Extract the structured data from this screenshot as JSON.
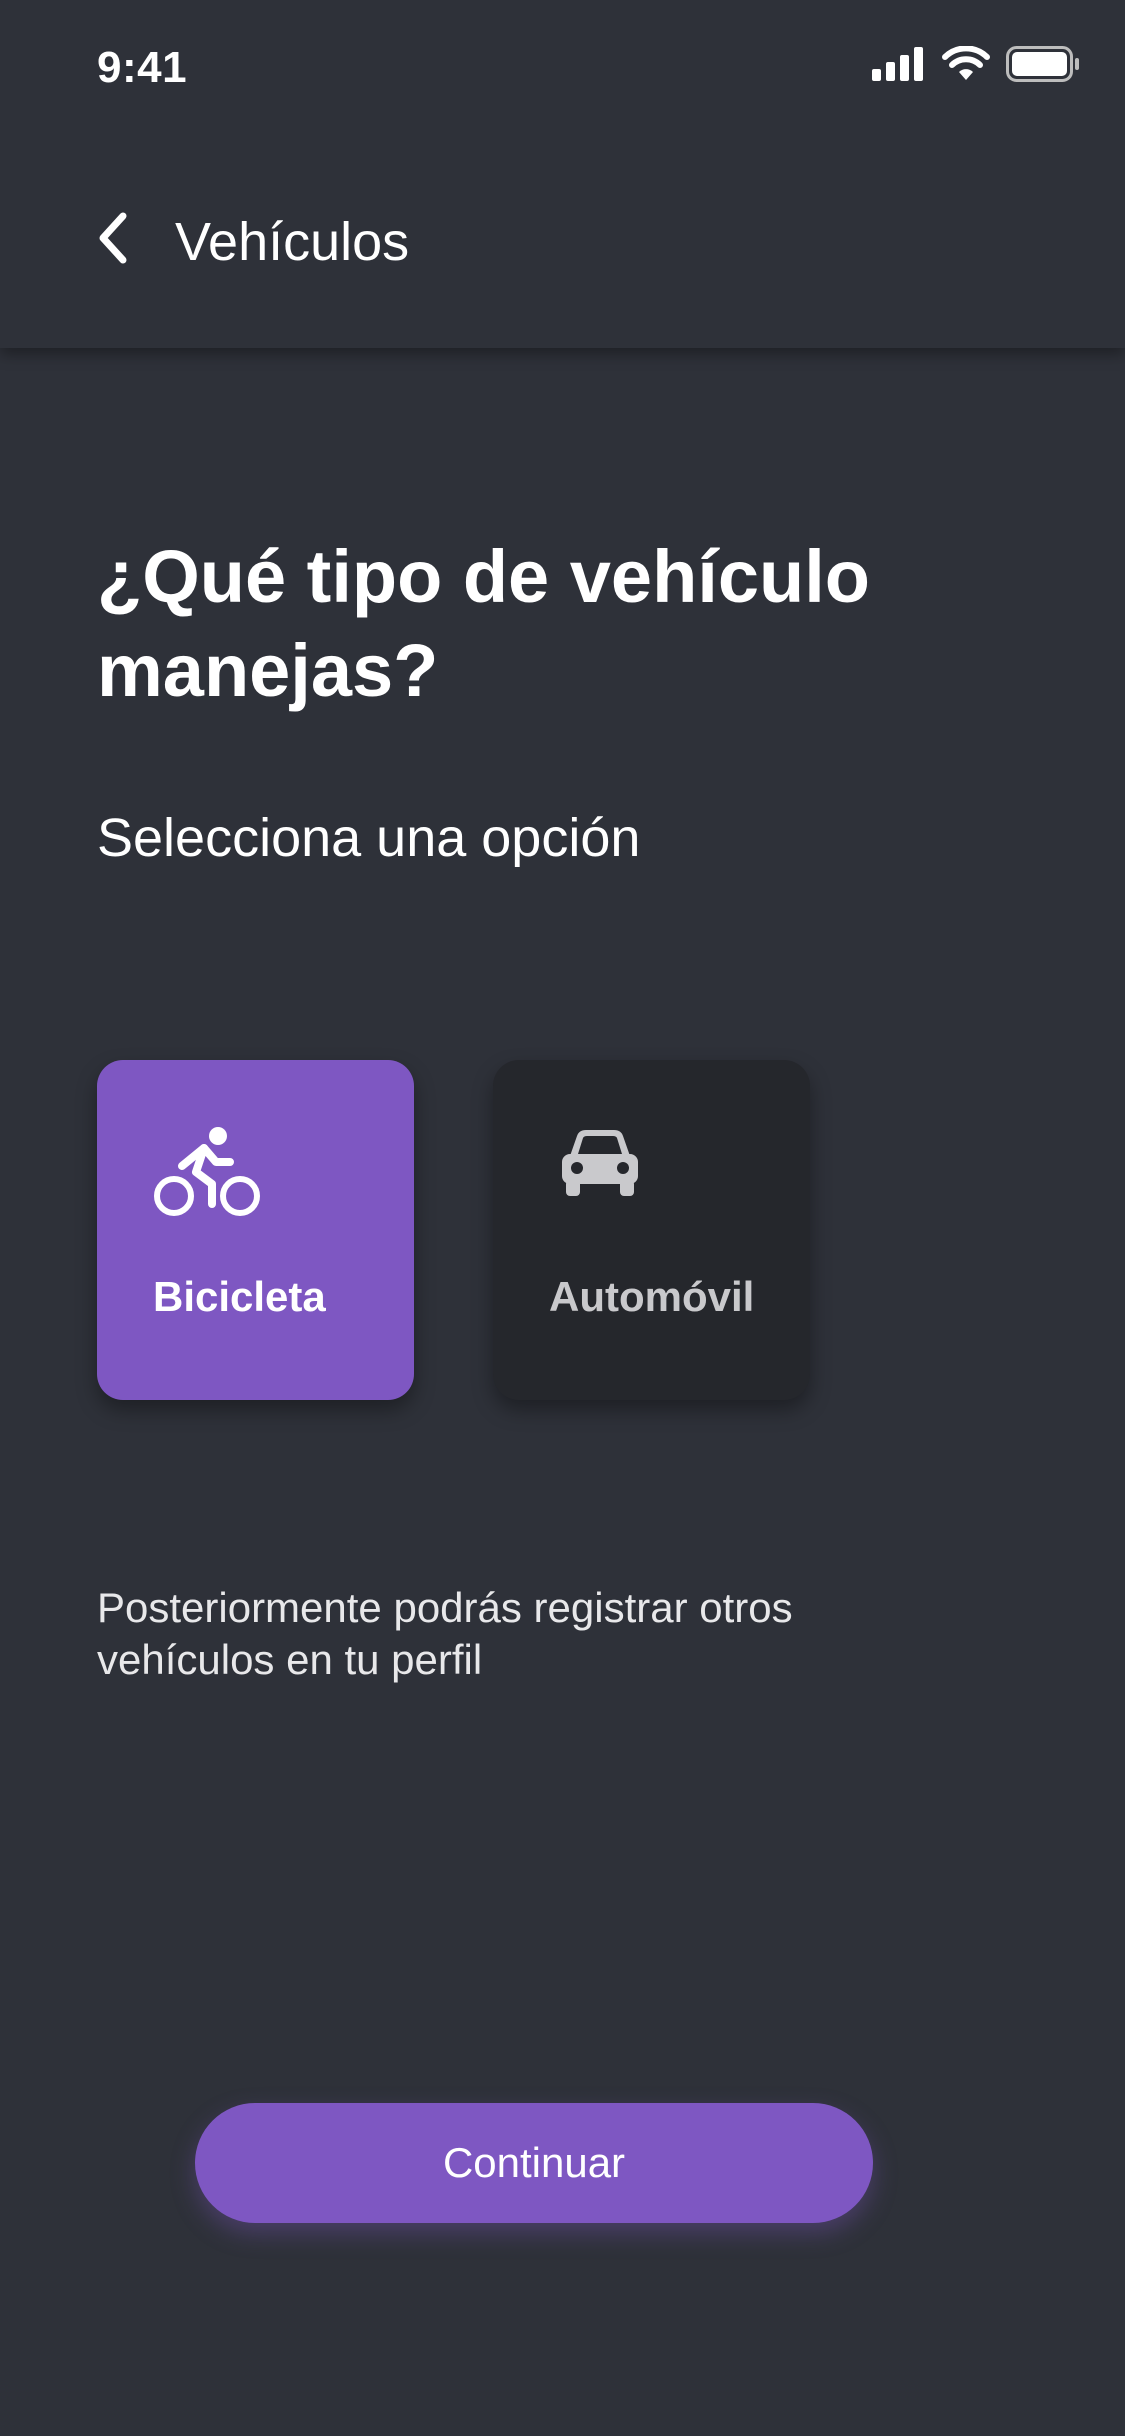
{
  "status_bar": {
    "time": "9:41",
    "icons": [
      "signal-icon",
      "wifi-icon",
      "battery-icon"
    ]
  },
  "header": {
    "back_icon": "chevron-left-icon",
    "title": "Vehículos"
  },
  "main": {
    "question": "¿Qué tipo de vehículo manejas?",
    "subtitle": "Selecciona una opción",
    "options": [
      {
        "label": "Bicicleta",
        "icon": "bicycle-icon",
        "selected": true
      },
      {
        "label": "Automóvil",
        "icon": "car-icon",
        "selected": false
      }
    ],
    "note": "Posteriormente podrás registrar otros vehículos en tu perfil",
    "continue_label": "Continuar"
  },
  "colors": {
    "background": "#2e3139",
    "accent": "#7e57c2",
    "card_unselected": "#25272c",
    "text": "#ffffff"
  }
}
